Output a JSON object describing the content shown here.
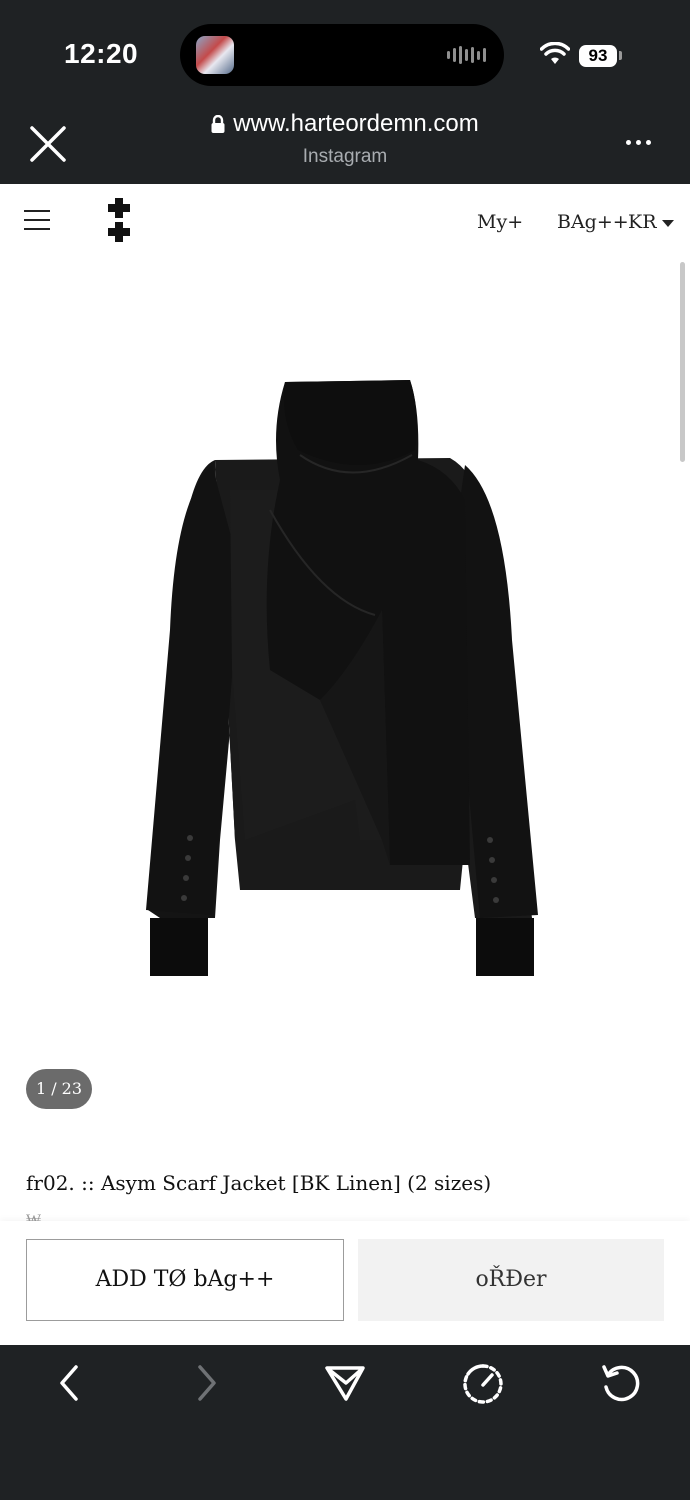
{
  "status_bar": {
    "time": "12:20",
    "battery": "93"
  },
  "browser": {
    "url": "www.harteordemn.com",
    "source": "Instagram"
  },
  "site_header": {
    "my_label": "My+",
    "bag_label": "BAg++",
    "currency_label": "KR"
  },
  "gallery": {
    "counter": "1 / 23"
  },
  "product": {
    "title": "fr02. :: Asym Scarf Jacket [BK Linen] (2 sizes)",
    "price_peek": "₩"
  },
  "actions": {
    "add_to_bag_label": "ADD TØ bAg++",
    "order_label": "oŘĐer"
  },
  "icons": {
    "close": "close-icon",
    "lock": "lock-icon",
    "more": "more-icon",
    "menu": "hamburger-menu-icon",
    "logo": "double-cross-logo",
    "back": "chevron-left-icon",
    "forward": "chevron-right-icon",
    "share": "send-icon",
    "speed": "speedometer-icon",
    "reload": "reload-icon"
  },
  "colors": {
    "chrome": "#1f2224",
    "order_bg": "#f2f2f2",
    "counter_bg": "#6b6b6b"
  }
}
